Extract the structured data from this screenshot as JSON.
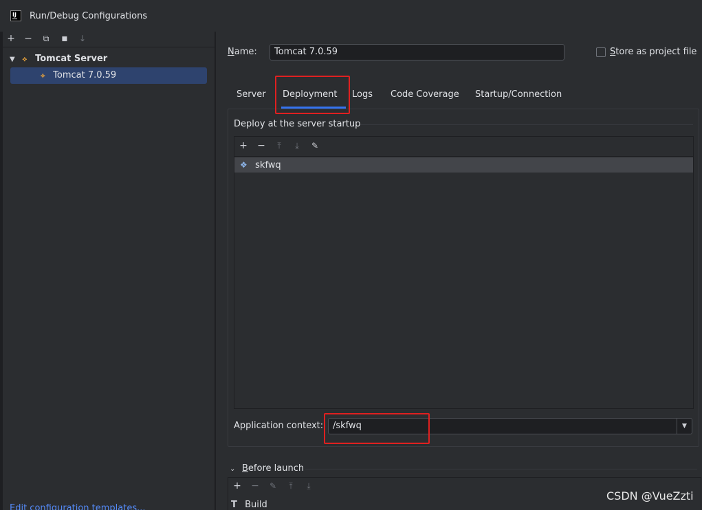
{
  "window": {
    "title": "Run/Debug Configurations",
    "app_icon": "IJ"
  },
  "left_toolbar": {
    "icons": [
      "add-icon",
      "remove-icon",
      "copy-icon",
      "new-folder-icon",
      "sort-icon"
    ],
    "glyphs": {
      "add": "+",
      "remove": "−",
      "copy": "⧉",
      "folder": "▪",
      "sort": "↓"
    }
  },
  "tree": {
    "group_label": "Tomcat Server",
    "group_arrow": "▼",
    "tomcat_glyph": "⟡",
    "item_label": "Tomcat 7.0.59"
  },
  "edit_templates_link": "Edit configuration templates...",
  "form": {
    "name_label_underlined": "N",
    "name_label_rest": "ame:",
    "name_value": "Tomcat 7.0.59",
    "store_label_underlined": "S",
    "store_label_rest": "tore as project file",
    "store_checked": false
  },
  "tabs": [
    "Server",
    "Deployment",
    "Logs",
    "Code Coverage",
    "Startup/Connection"
  ],
  "active_tab": "Deployment",
  "deployment": {
    "section_title": "Deploy at the server startup",
    "toolbar_glyphs": {
      "add": "+",
      "remove": "−",
      "up": "⤒",
      "down": "⤓",
      "edit": "✎"
    },
    "artifact_glyph": "❖",
    "artifacts": [
      "skfwq"
    ],
    "app_context_label": "Application context:",
    "app_context_value": "/skfwq",
    "dropdown_glyph": "▼"
  },
  "before_launch": {
    "chevron": "⌄",
    "label_underlined": "B",
    "label_rest": "efore launch",
    "build_glyph": "T",
    "items": [
      "Build"
    ]
  },
  "watermark": "CSDN @VueZzti",
  "colors": {
    "accent": "#3574f0",
    "selection": "#2e436e",
    "annotation_red": "#e02020",
    "link": "#548af7"
  }
}
